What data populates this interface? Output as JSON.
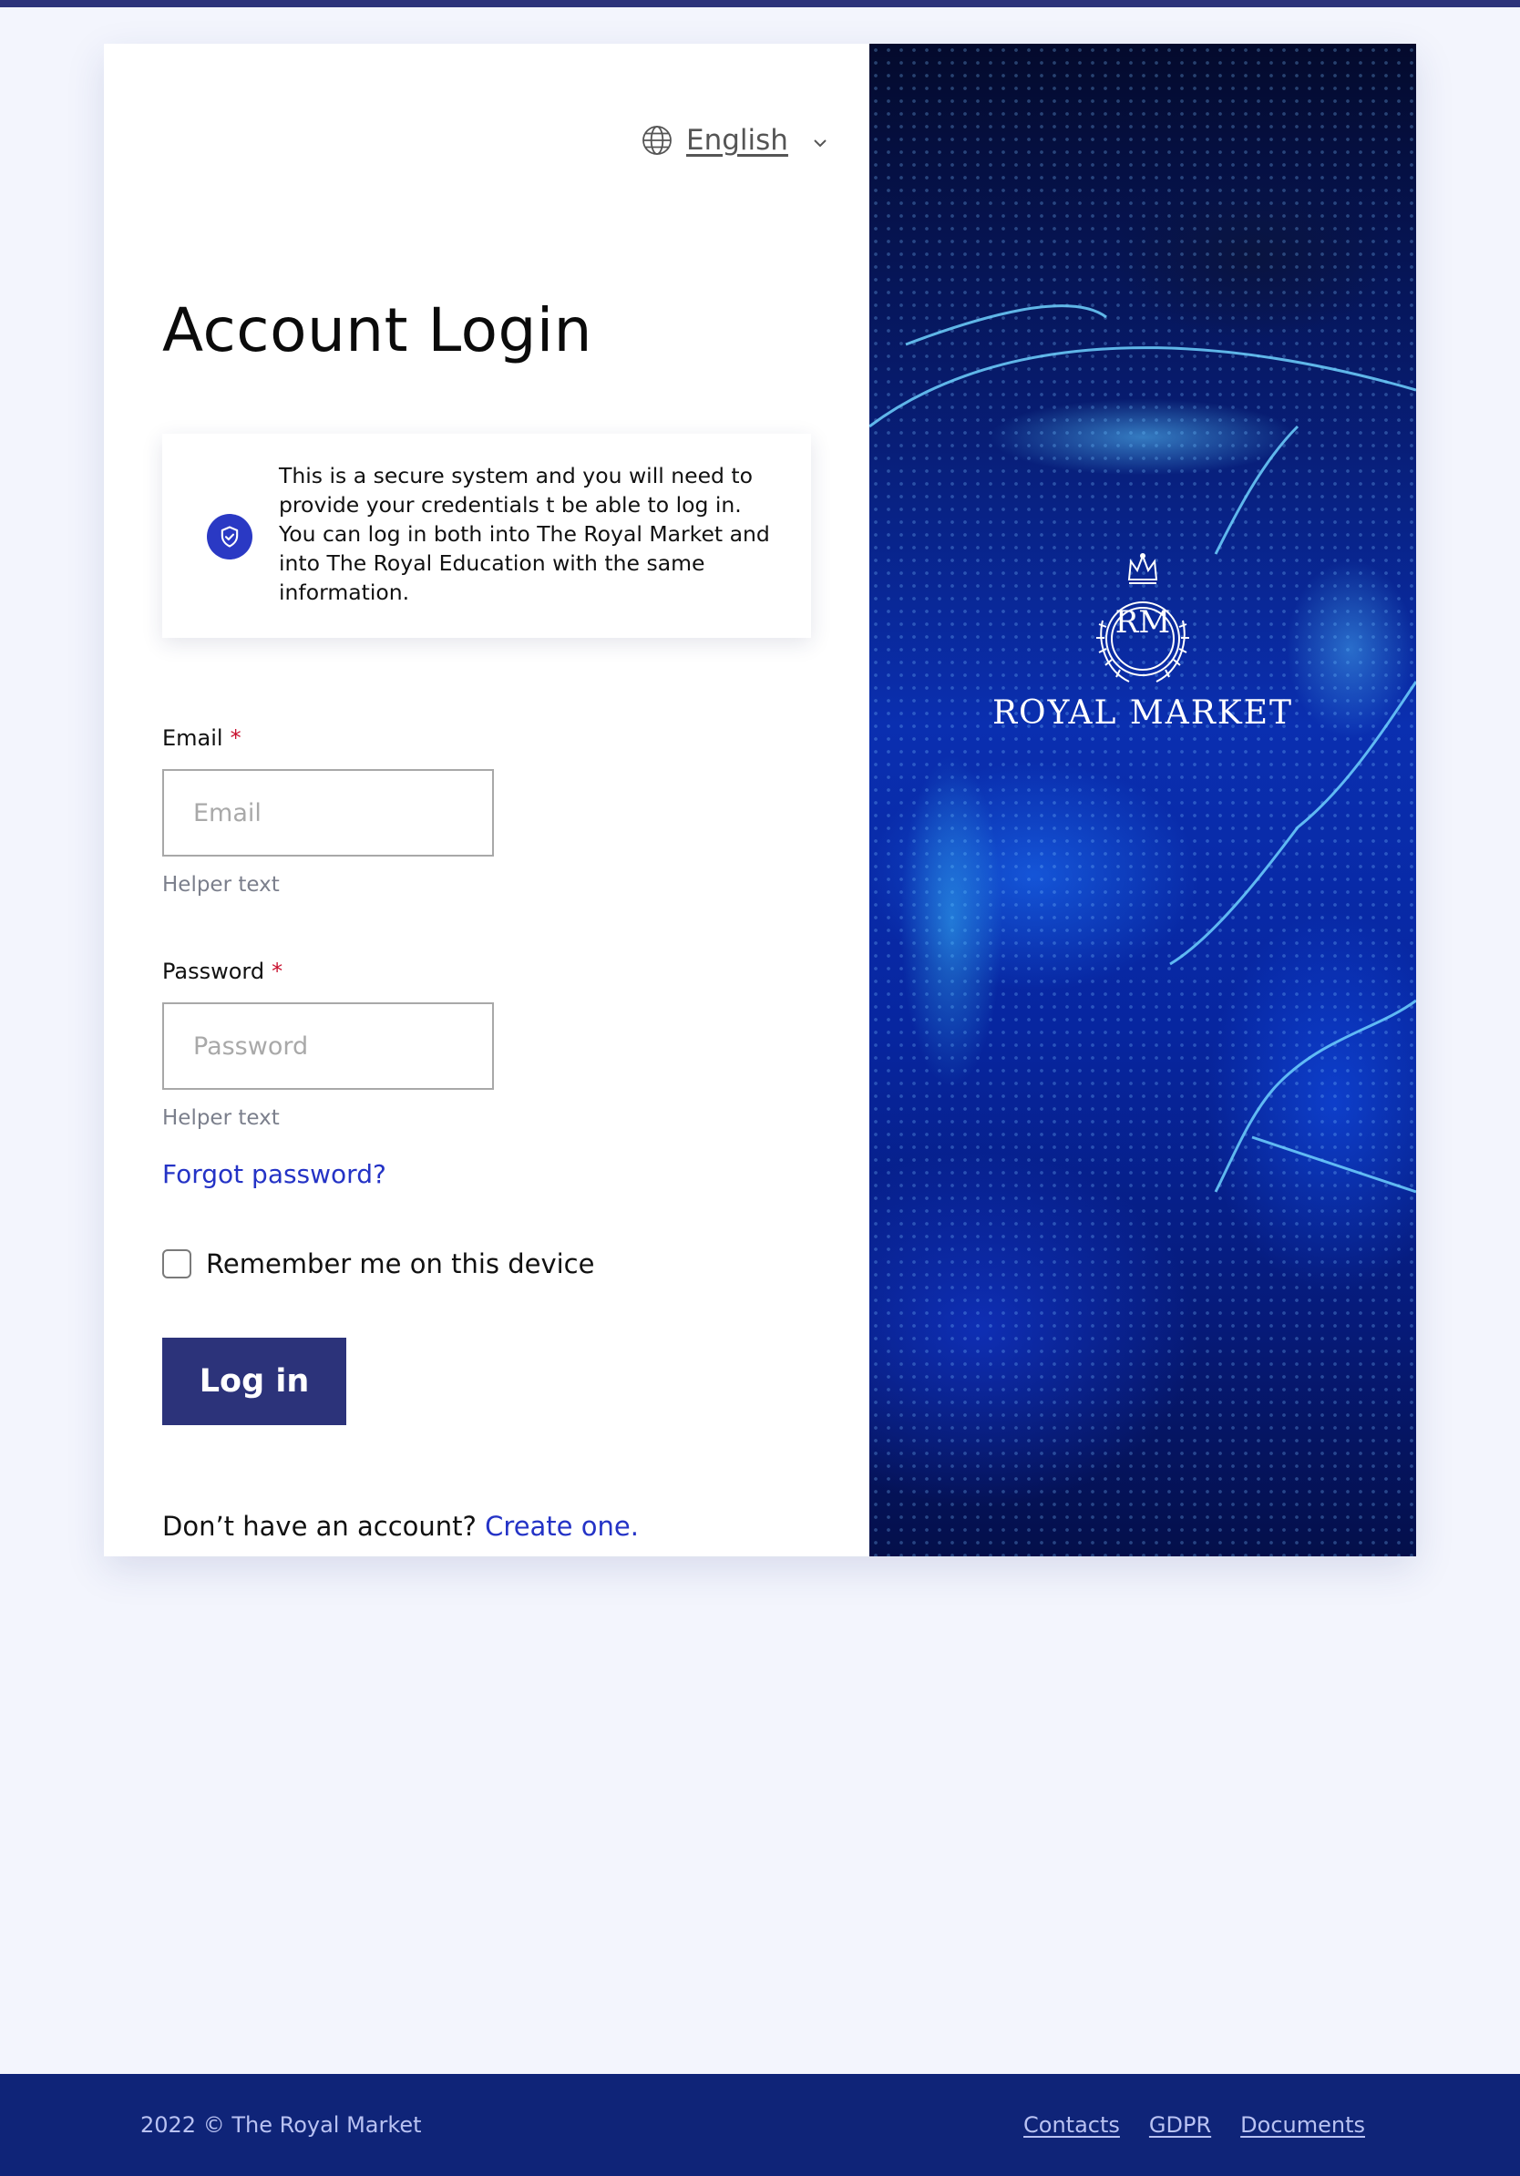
{
  "language": {
    "selected": "English"
  },
  "login": {
    "title": "Account Login",
    "notice": "This is a secure system and you will need to provide your credentials t be able to log in. You can log in both into The Royal Market and into The Royal Education with the same information.",
    "email": {
      "label": "Email",
      "required_mark": "*",
      "placeholder": "Email",
      "value": "",
      "helper": "Helper text"
    },
    "password": {
      "label": "Password",
      "required_mark": "*",
      "placeholder": "Password",
      "value": "",
      "helper": "Helper text"
    },
    "forgot_password": "Forgot password?",
    "remember_me": {
      "label": "Remember me on this device",
      "checked": false
    },
    "submit_label": "Log in",
    "signup_prompt": "Don’t have an account?",
    "signup_link": "Create one."
  },
  "brand": {
    "monogram": "RM",
    "name": "ROYAL MARKET"
  },
  "footer": {
    "copyright": "2022 © The Royal Market",
    "links": [
      "Contacts",
      "GDPR",
      "Documents"
    ]
  },
  "colors": {
    "primary_button": "#2c337a",
    "link": "#2433c6",
    "footer_bg": "#0f2478",
    "page_bg": "#f3f5fd",
    "required": "#c8102e"
  },
  "icons": {
    "language": "globe-icon",
    "dropdown": "chevron-down-icon",
    "notice": "shield-check-icon",
    "brand": "crown-icon"
  }
}
